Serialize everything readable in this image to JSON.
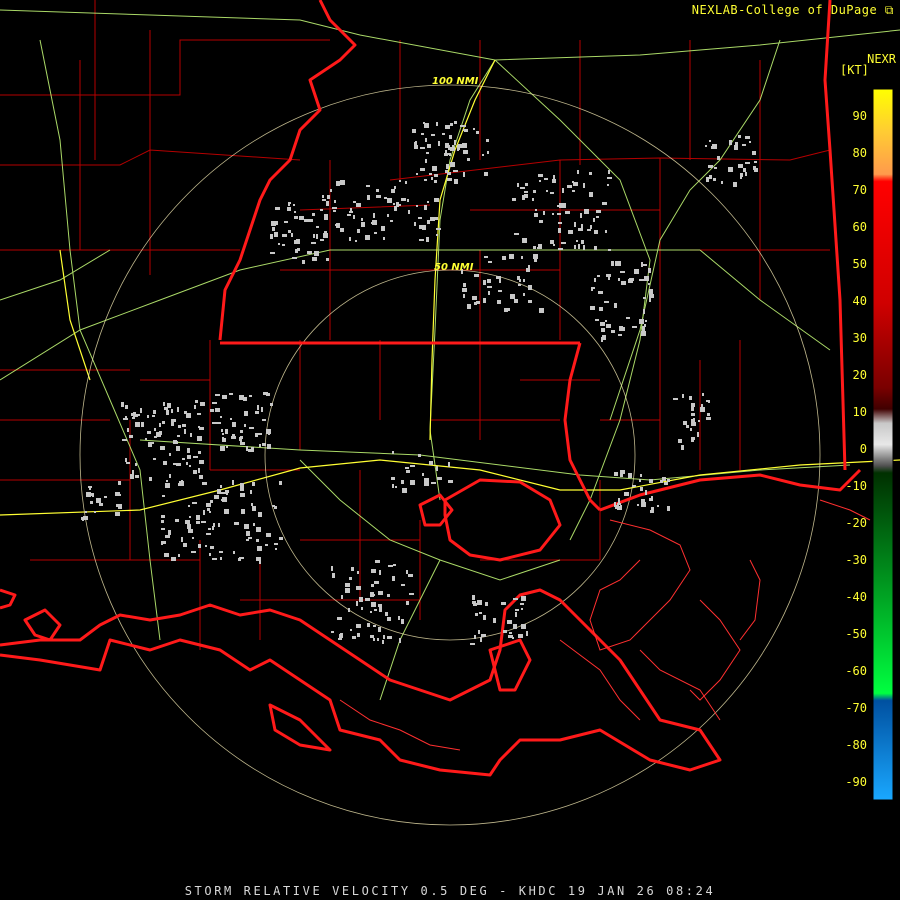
{
  "header": {
    "credit": "NEXLAB-College of DuPage",
    "credit_icon": "external-link-icon",
    "product": "NEXR",
    "units": "[KT]"
  },
  "rings": {
    "outer_label": "100 NMI",
    "inner_label": "50 NMI"
  },
  "legend": {
    "ticks": [
      "90",
      "80",
      "70",
      "60",
      "50",
      "40",
      "30",
      "20",
      "10",
      "0",
      "-10",
      "-20",
      "-30",
      "-40",
      "-50",
      "-60",
      "-70",
      "-80",
      "-90"
    ],
    "colors": {
      "high_yellow": "#ffff00",
      "orange": "#ff9a4c",
      "red": "#ff0000",
      "dark_red": "#600000",
      "gray": "#c8c8c8",
      "dark_green": "#004a00",
      "green": "#00ff40",
      "blue": "#1aa8ff"
    }
  },
  "footer": {
    "caption": "STORM RELATIVE VELOCITY 0.5 DEG - KHDC 19 JAN 26 08:24"
  },
  "map_colors": {
    "coast": "#ff1a1a",
    "county": "#b50000",
    "highway": "#c8ff7a",
    "range_ring": "#f0e6b0",
    "echo": "#c8c8c8"
  }
}
